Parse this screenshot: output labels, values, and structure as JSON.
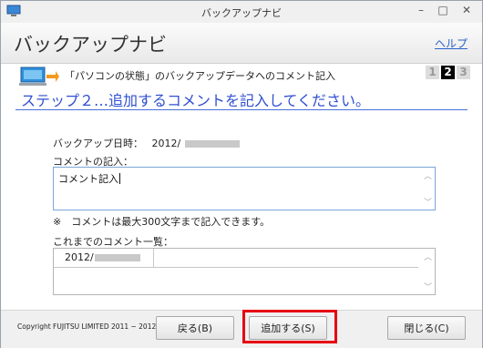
{
  "window": {
    "title": "バックアップナビ",
    "minimize_glyph": "–",
    "maximize_glyph": "□",
    "close_glyph": "✕"
  },
  "header": {
    "app_title": "バックアップナビ",
    "help_link": "ヘルプ"
  },
  "step_bar": {
    "caption": "「パソコンの状態」のバックアップデータへのコメント記入",
    "steps": [
      "1",
      "2",
      "3"
    ],
    "current_step": 2
  },
  "step": {
    "title": "ステップ２…追加するコメントを記入してください。"
  },
  "form": {
    "backup_date_label": "バックアップ日時：",
    "backup_date_value": "2012/",
    "comment_label": "コメントの記入：",
    "comment_value": "コメント記入",
    "note": "※　コメントは最大300文字まで記入できます。",
    "list_label": "これまでのコメント一覧：",
    "list_rows": [
      {
        "date": "2012/",
        "comment": ""
      }
    ]
  },
  "footer": {
    "copyright": "Copyright FUJITSU LIMITED 2011 − 2012",
    "back_button": "戻る(B)",
    "add_button": "追加する(S)",
    "close_button": "閉じる(C)"
  },
  "colors": {
    "accent_blue": "#2f4fd2",
    "link_blue": "#2a62c9",
    "highlight_red": "#e60012",
    "current_step_bg": "#000000"
  }
}
